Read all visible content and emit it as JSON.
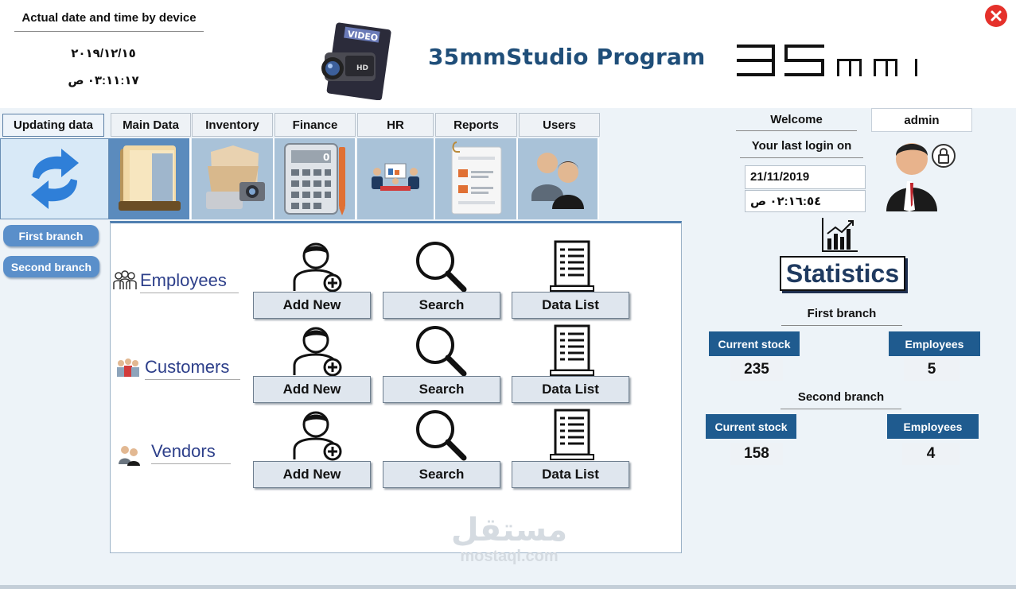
{
  "header": {
    "date_label": "Actual date and time by device",
    "date_value": "٢٠١٩/١٢/١٥",
    "time_value": "٠٣:١١:١٧ ص",
    "app_title": "35mmStudio Program",
    "camera_logo_text": "VIDEO",
    "brand_logo_text": "35mm"
  },
  "nav": {
    "update_label": "Updating data",
    "tabs": [
      {
        "label": "Main Data",
        "icon": "folder-icon",
        "active": true
      },
      {
        "label": "Inventory",
        "icon": "inventory-icon",
        "active": false
      },
      {
        "label": "Finance",
        "icon": "calculator-icon",
        "active": false
      },
      {
        "label": "HR",
        "icon": "meeting-icon",
        "active": false
      },
      {
        "label": "Reports",
        "icon": "report-icon",
        "active": false
      },
      {
        "label": "Users",
        "icon": "users-icon",
        "active": false
      }
    ]
  },
  "branches": {
    "first": "First branch",
    "second": "Second branch"
  },
  "sections": [
    {
      "label": "Employees",
      "add": "Add New",
      "search": "Search",
      "list": "Data List"
    },
    {
      "label": "Customers",
      "add": "Add New",
      "search": "Search",
      "list": "Data List"
    },
    {
      "label": "Vendors",
      "add": "Add New",
      "search": "Search",
      "list": "Data List"
    }
  ],
  "user": {
    "welcome": "Welcome",
    "username": "admin",
    "last_login_label": "Your last login on",
    "last_login_date": "21/11/2019",
    "last_login_time": "٠٢:١٦:٥٤ ص"
  },
  "statistics": {
    "title": "Statistics",
    "branches": [
      {
        "name": "First branch",
        "stock_label": "Current stock",
        "stock": "235",
        "employees_label": "Employees",
        "employees": "5"
      },
      {
        "name": "Second branch",
        "stock_label": "Current stock",
        "stock": "158",
        "employees_label": "Employees",
        "employees": "4"
      }
    ]
  },
  "watermark": {
    "arabic": "مستقل",
    "url": "mostaql.com"
  },
  "colors": {
    "title_blue": "#1f4e79",
    "stat_label_bg": "#1f5b8f",
    "branch_btn_bg": "#5a8fca",
    "close_red": "#e5312b"
  }
}
